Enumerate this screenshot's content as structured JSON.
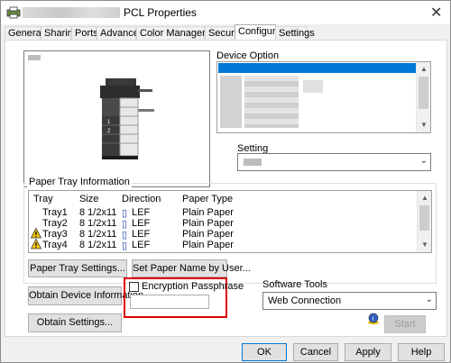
{
  "window": {
    "title": "PCL Properties",
    "close_glyph": "✕"
  },
  "tabs": [
    {
      "label": "General"
    },
    {
      "label": "Sharing"
    },
    {
      "label": "Ports"
    },
    {
      "label": "Advanced"
    },
    {
      "label": "Color Management"
    },
    {
      "label": "Security"
    },
    {
      "label": "Configure"
    },
    {
      "label": "Settings"
    }
  ],
  "configure": {
    "device_option_label": "Device Option",
    "setting_label": "Setting",
    "paper_tray_info_label": "Paper Tray Information",
    "table": {
      "headers": [
        "Tray",
        "Size",
        "Direction",
        "Paper Type"
      ],
      "rows": [
        {
          "tray": "Tray1",
          "size": "8 1/2x11",
          "direction": "LEF",
          "type": "Plain Paper",
          "warning": false
        },
        {
          "tray": "Tray2",
          "size": "8 1/2x11",
          "direction": "LEF",
          "type": "Plain Paper",
          "warning": false
        },
        {
          "tray": "Tray3",
          "size": "8 1/2x11",
          "direction": "LEF",
          "type": "Plain Paper",
          "warning": true
        },
        {
          "tray": "Tray4",
          "size": "8 1/2x11",
          "direction": "LEF",
          "type": "Plain Paper",
          "warning": true
        }
      ]
    },
    "paper_tray_settings_button": "Paper Tray Settings...",
    "set_paper_name_button": "Set Paper Name by User...",
    "obtain_device_info_button": "Obtain Device Information",
    "obtain_settings_button": "Obtain Settings...",
    "encryption_checkbox_label": "Encryption Passphrase",
    "encryption_checked": false,
    "passphrase_value": "",
    "software_tools_label": "Software Tools",
    "software_tools_value": "Web Connection",
    "start_button": "Start"
  },
  "footer": {
    "ok": "OK",
    "cancel": "Cancel",
    "apply": "Apply",
    "help": "Help"
  },
  "colors": {
    "highlight": "#0078d7",
    "callout": "#e00000"
  }
}
